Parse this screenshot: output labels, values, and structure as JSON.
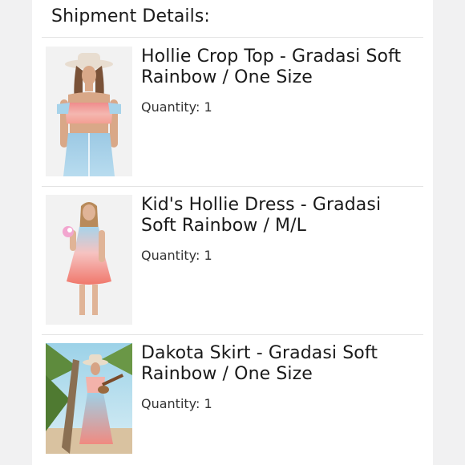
{
  "section": {
    "title": "Shipment Details:"
  },
  "items": [
    {
      "name": "Hollie Crop Top - Gradasi Soft Rainbow / One Size",
      "quantity_label": "Quantity: 1",
      "image_icon": "product-photo-crop-top"
    },
    {
      "name": "Kid's Hollie Dress - Gradasi Soft Rainbow / M/L",
      "quantity_label": "Quantity: 1",
      "image_icon": "product-photo-kids-dress"
    },
    {
      "name": "Dakota Skirt - Gradasi Soft Rainbow / One Size",
      "quantity_label": "Quantity: 1",
      "image_icon": "product-photo-skirt"
    }
  ],
  "colors": {
    "page_background": "#f1f1f2",
    "card_background": "#ffffff",
    "divider": "#e3e3e3",
    "text": "#1a1a1a"
  }
}
